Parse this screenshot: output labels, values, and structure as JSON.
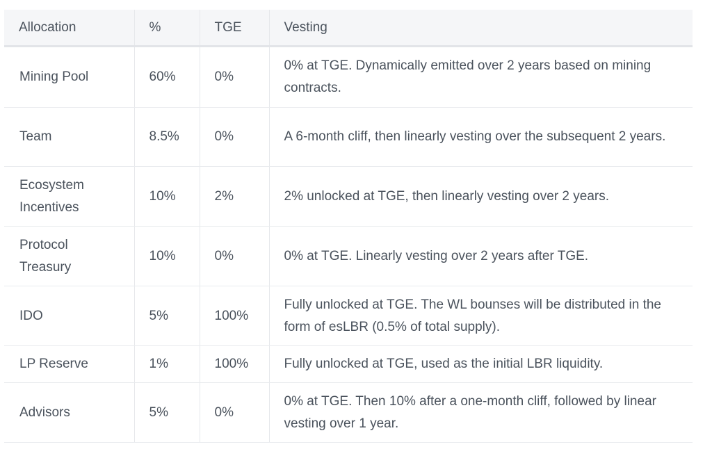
{
  "table": {
    "headers": [
      "Allocation",
      "%",
      "TGE",
      "Vesting"
    ],
    "rows": [
      {
        "allocation": "Mining Pool",
        "percent": "60%",
        "tge": "0%",
        "vesting": "0% at TGE. Dynamically emitted over 2 years based on mining contracts."
      },
      {
        "allocation": "Team",
        "percent": "8.5%",
        "tge": "0%",
        "vesting": "A 6-month cliff, then linearly vesting over the subsequent 2 years."
      },
      {
        "allocation": "Ecosystem Incentives",
        "percent": "10%",
        "tge": "2%",
        "vesting": "2% unlocked at TGE, then linearly vesting over 2 years."
      },
      {
        "allocation": "Protocol Treasury",
        "percent": "10%",
        "tge": "0%",
        "vesting": "0% at TGE. Linearly vesting over 2 years after TGE."
      },
      {
        "allocation": "IDO",
        "percent": "5%",
        "tge": "100%",
        "vesting": "Fully unlocked at TGE. The WL bounses will be distributed in the form of esLBR (0.5% of total supply)."
      },
      {
        "allocation": "LP Reserve",
        "percent": "1%",
        "tge": "100%",
        "vesting": "Fully unlocked at TGE, used as the initial LBR liquidity."
      },
      {
        "allocation": "Advisors",
        "percent": "5%",
        "tge": "0%",
        "vesting": "0% at TGE. Then 10% after a one-month cliff, followed by linear vesting over 1 year."
      }
    ]
  },
  "colors": {
    "header_bg": "#f5f6f8",
    "text": "#4a525c",
    "border": "#e6e8eb"
  }
}
